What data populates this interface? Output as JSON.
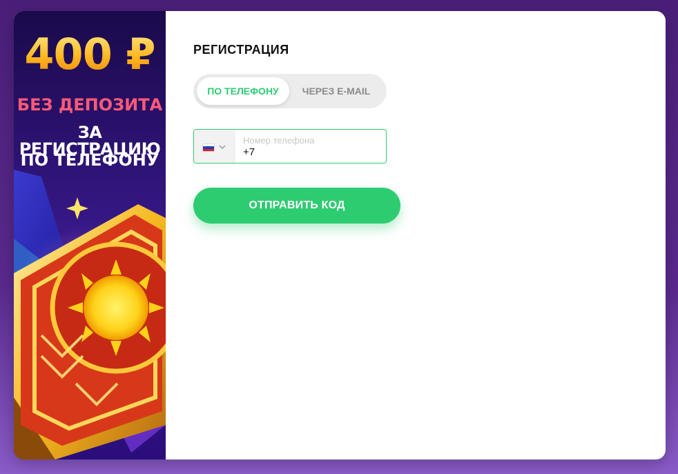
{
  "banner": {
    "amount": "400 ₽",
    "line1": "БЕЗ ДЕПОЗИТА",
    "line2": "ЗА РЕГИСТРАЦИЮ",
    "line3": "ПО ТЕЛЕФОНУ"
  },
  "form": {
    "title": "РЕГИСТРАЦИЯ",
    "tabs": [
      {
        "label": "ПО ТЕЛЕФОНУ",
        "active": true
      },
      {
        "label": "ЧЕРЕЗ E-MAIL",
        "active": false
      }
    ],
    "phone": {
      "country_icon": "russia-flag-icon",
      "placeholder": "Номер телефона",
      "prefix": "+7"
    },
    "submit_label": "ОТПРАВИТЬ КОД"
  },
  "colors": {
    "accent": "#2ecc71",
    "backdrop": "#4a1f7a",
    "banner_pink": "#ff5a78",
    "banner_gold": "#ffc93a"
  }
}
